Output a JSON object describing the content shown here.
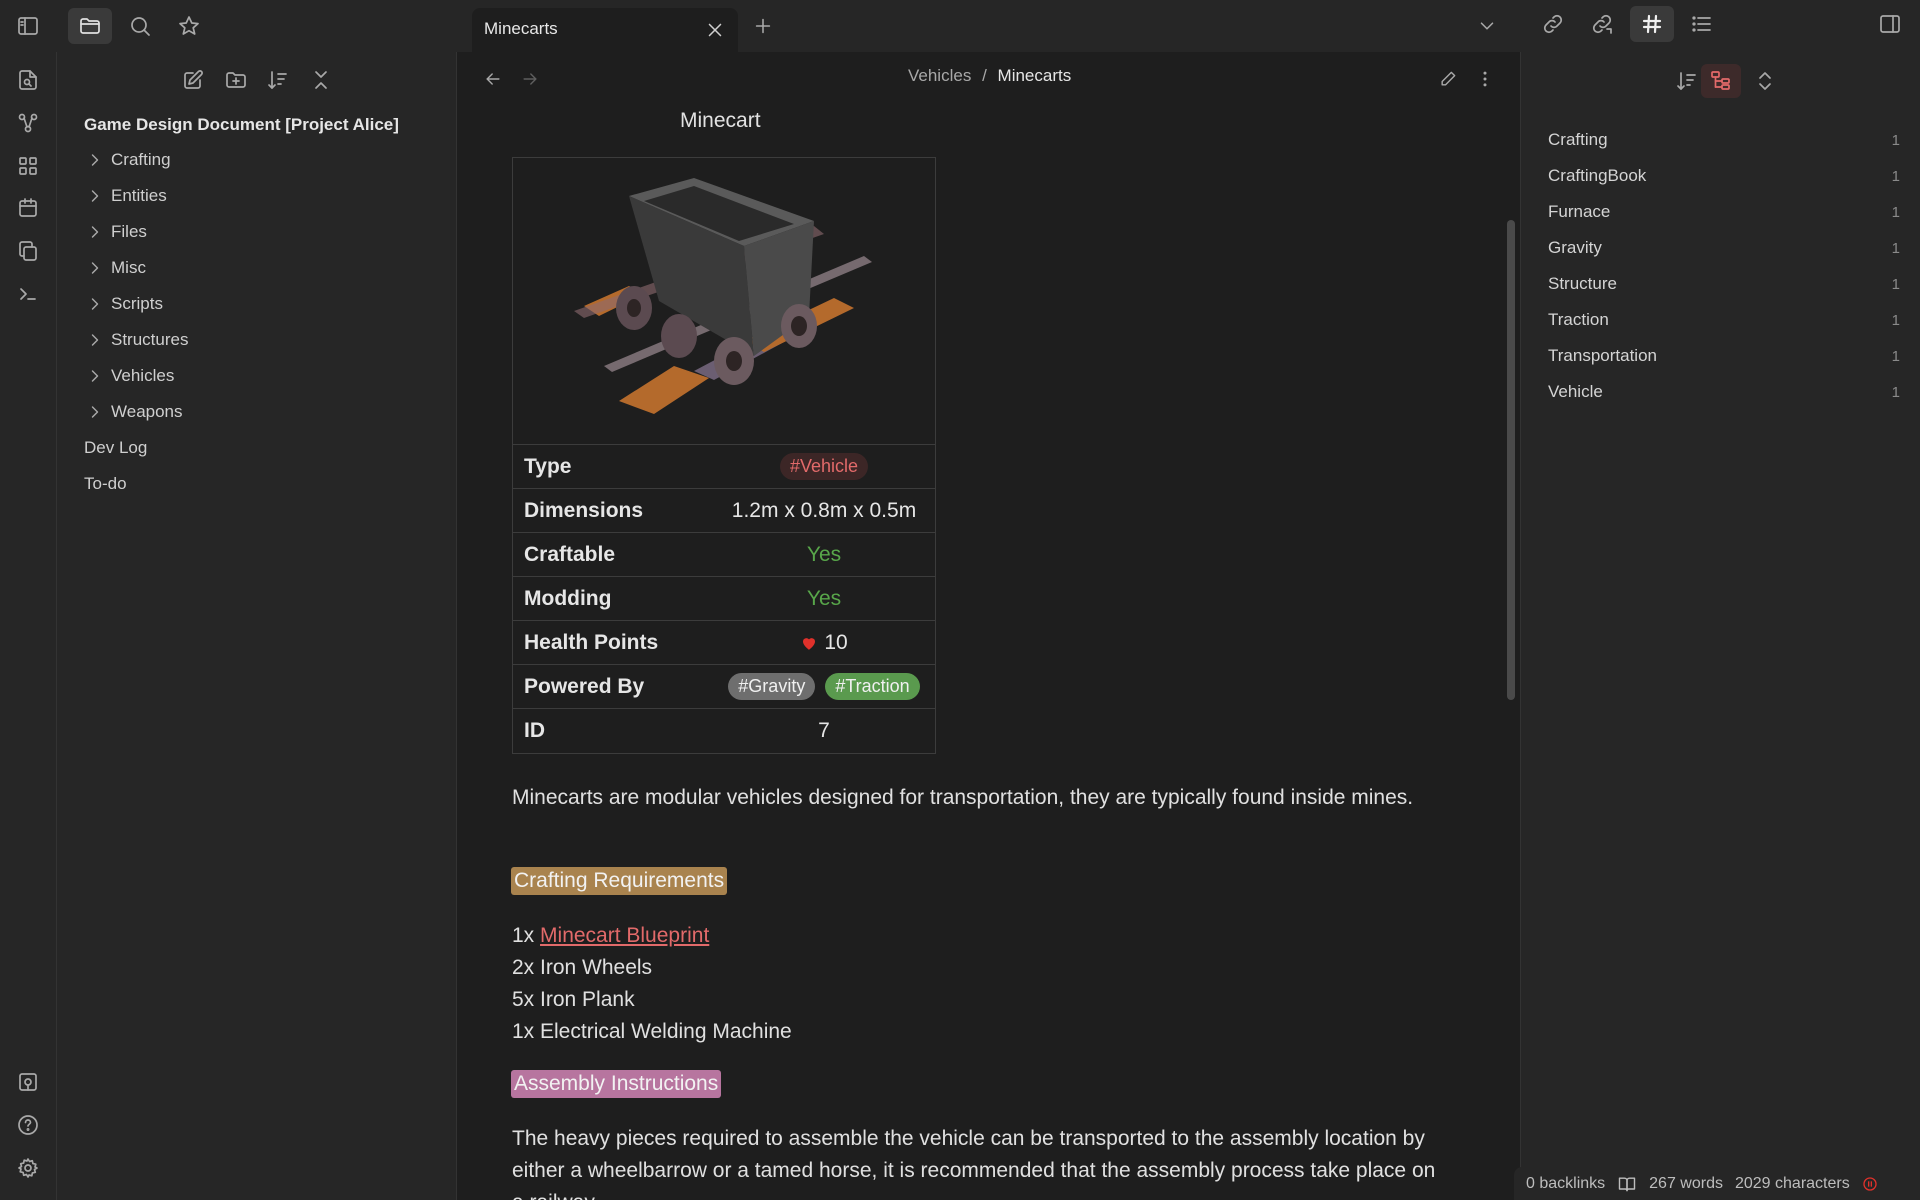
{
  "window": {
    "tab_title": "Minecarts"
  },
  "icons": {
    "sidebar_toggle": "sidebar-left-icon",
    "files": "folder-icon",
    "search": "search-icon",
    "bookmarks": "star-icon"
  },
  "explorer": {
    "vault_name": "Game Design Document [Project Alice]",
    "folders": [
      "Crafting",
      "Entities",
      "Files",
      "Misc",
      "Scripts",
      "Structures",
      "Vehicles",
      "Weapons"
    ],
    "files": [
      "Dev Log",
      "To-do"
    ]
  },
  "main": {
    "breadcrumb": {
      "parent": "Vehicles",
      "separator": "/",
      "current": "Minecarts"
    },
    "infobox": {
      "title": "Minecart",
      "rows": {
        "type": {
          "key": "Type",
          "value": "#Vehicle"
        },
        "dimensions": {
          "key": "Dimensions",
          "value": "1.2m x 0.8m x 0.5m"
        },
        "craftable": {
          "key": "Craftable",
          "value": "Yes"
        },
        "modding": {
          "key": "Modding",
          "value": "Yes"
        },
        "health": {
          "key": "Health Points",
          "value": "10"
        },
        "powered_by": {
          "key": "Powered By",
          "tag1": "#Gravity",
          "tag2": "#Traction"
        },
        "id": {
          "key": "ID",
          "value": "7"
        }
      }
    },
    "intro": "Minecarts are modular vehicles designed for transportation, they are typically found inside mines.",
    "crafting_heading": "Crafting Requirements",
    "crafting": {
      "item1_qty": "1x",
      "item1_link": "Minecart Blueprint",
      "item2": "2x Iron Wheels",
      "item3": "5x Iron Plank",
      "item4": "1x Electrical Welding Machine"
    },
    "assembly_heading": "Assembly Instructions",
    "assembly_text": "The heavy pieces required to assemble the vehicle can be transported to the assembly location by either a wheelbarrow or a tamed horse, it is recommended that the assembly process take place on a railway."
  },
  "tags_panel": {
    "tags": [
      {
        "name": "Crafting",
        "count": "1"
      },
      {
        "name": "CraftingBook",
        "count": "1"
      },
      {
        "name": "Furnace",
        "count": "1"
      },
      {
        "name": "Gravity",
        "count": "1"
      },
      {
        "name": "Structure",
        "count": "1"
      },
      {
        "name": "Traction",
        "count": "1"
      },
      {
        "name": "Transportation",
        "count": "1"
      },
      {
        "name": "Vehicle",
        "count": "1"
      }
    ]
  },
  "status": {
    "backlinks": "0 backlinks",
    "words": "267 words",
    "characters": "2029 characters"
  },
  "colors": {
    "accent": "#e26a6a",
    "highlight_orange": "#a9834e",
    "highlight_purple": "#b7759f",
    "tag_green": "#5a9a4e",
    "yes_green": "#58a64a"
  }
}
